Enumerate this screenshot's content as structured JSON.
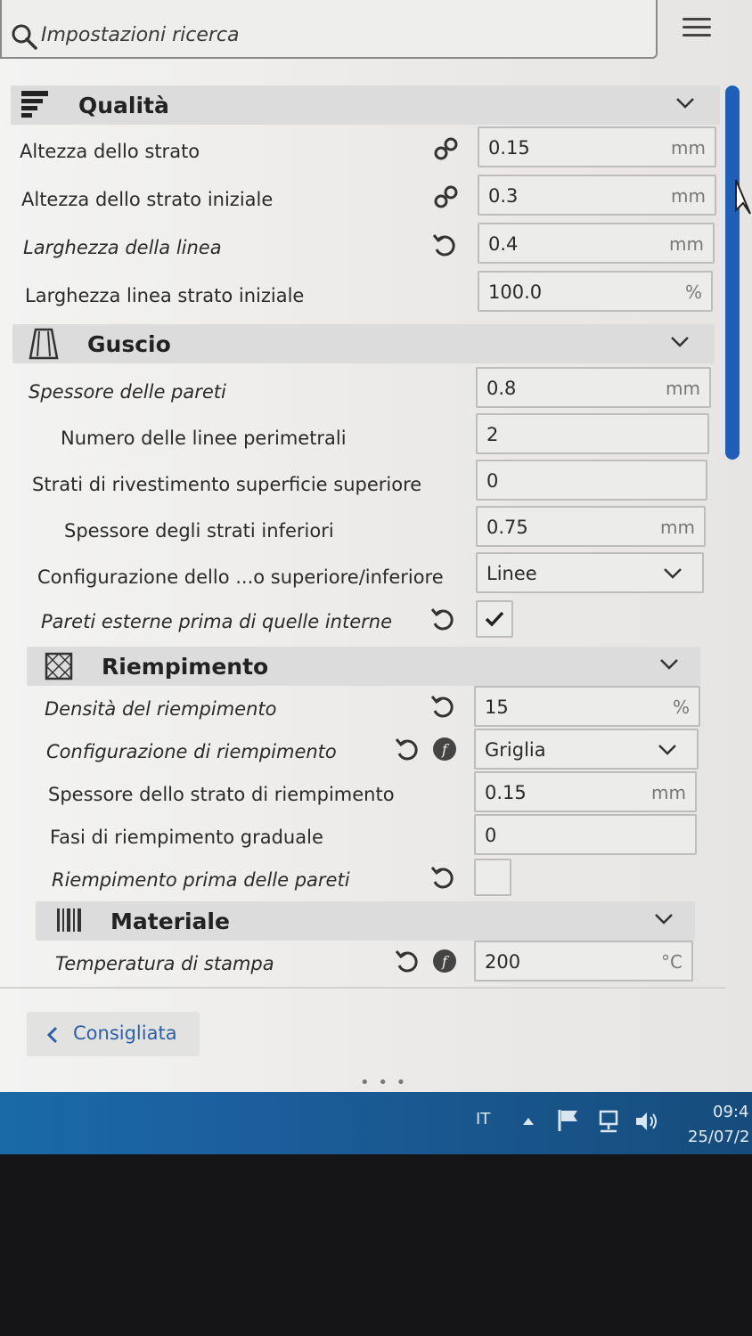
{
  "search": {
    "placeholder": "Impostazioni ricerca"
  },
  "sections": {
    "quality": {
      "title": "Qualità"
    },
    "shell": {
      "title": "Guscio"
    },
    "infill": {
      "title": "Riempimento"
    },
    "material": {
      "title": "Materiale"
    }
  },
  "settings": {
    "layer_height": {
      "label": "Altezza dello strato",
      "value": "0.15",
      "unit": "mm",
      "icon": "link-icon"
    },
    "initial_layer_height": {
      "label": "Altezza dello strato iniziale",
      "value": "0.3",
      "unit": "mm",
      "icon": "link-icon"
    },
    "line_width": {
      "label": "Larghezza della linea",
      "value": "0.4",
      "unit": "mm",
      "icon": "reset-icon"
    },
    "initial_line_width": {
      "label": "Larghezza linea strato iniziale",
      "value": "100.0",
      "unit": "%"
    },
    "wall_thickness": {
      "label": "Spessore delle pareti",
      "value": "0.8",
      "unit": "mm"
    },
    "wall_line_count": {
      "label": "Numero delle linee perimetrali",
      "value": "2"
    },
    "top_layers": {
      "label": "Strati di rivestimento superficie superiore",
      "value": "0"
    },
    "bottom_thickness": {
      "label": "Spessore degli strati inferiori",
      "value": "0.75",
      "unit": "mm"
    },
    "top_bottom_pattern": {
      "label": "Configurazione dello ...o superiore/inferiore",
      "value": "Linee"
    },
    "outer_before_inner": {
      "label": "Pareti esterne prima di quelle interne",
      "checked": true
    },
    "infill_density": {
      "label": "Densità del riempimento",
      "value": "15",
      "unit": "%"
    },
    "infill_pattern": {
      "label": "Configurazione di riempimento",
      "value": "Griglia"
    },
    "infill_layer_thickness": {
      "label": "Spessore dello strato di riempimento",
      "value": "0.15",
      "unit": "mm"
    },
    "gradual_infill": {
      "label": "Fasi di riempimento graduale",
      "value": "0"
    },
    "infill_before_walls": {
      "label": "Riempimento prima delle pareti",
      "checked": false
    },
    "print_temperature": {
      "label": "Temperatura di stampa",
      "value": "200",
      "unit": "°C"
    }
  },
  "footer": {
    "recommended_label": "Consigliata"
  },
  "taskbar": {
    "language": "IT",
    "time": "09:4",
    "date": "25/07/2"
  },
  "colors": {
    "accent": "#1f5fb8",
    "taskbar": "#1a6aa8"
  }
}
